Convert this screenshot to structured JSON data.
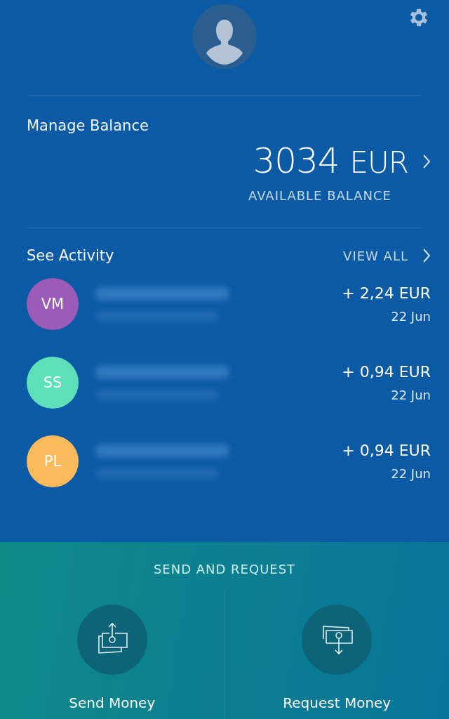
{
  "balance": {
    "title": "Manage Balance",
    "amount": "3034",
    "currency": "EUR",
    "caption": "AVAILABLE BALANCE"
  },
  "activity": {
    "title": "See Activity",
    "view_all": "VIEW ALL",
    "items": [
      {
        "initials": "VM",
        "color": "#9b5bb6",
        "amount": "+ 2,24 EUR",
        "date": "22 Jun"
      },
      {
        "initials": "SS",
        "color": "#5fdfb9",
        "amount": "+ 0,94 EUR",
        "date": "22 Jun"
      },
      {
        "initials": "PL",
        "color": "#fcba5a",
        "amount": "+ 0,94 EUR",
        "date": "22 Jun"
      }
    ]
  },
  "send_request": {
    "title": "SEND AND REQUEST",
    "actions": [
      {
        "kind": "send",
        "label": "Send Money"
      },
      {
        "kind": "request",
        "label": "Request Money"
      }
    ]
  }
}
